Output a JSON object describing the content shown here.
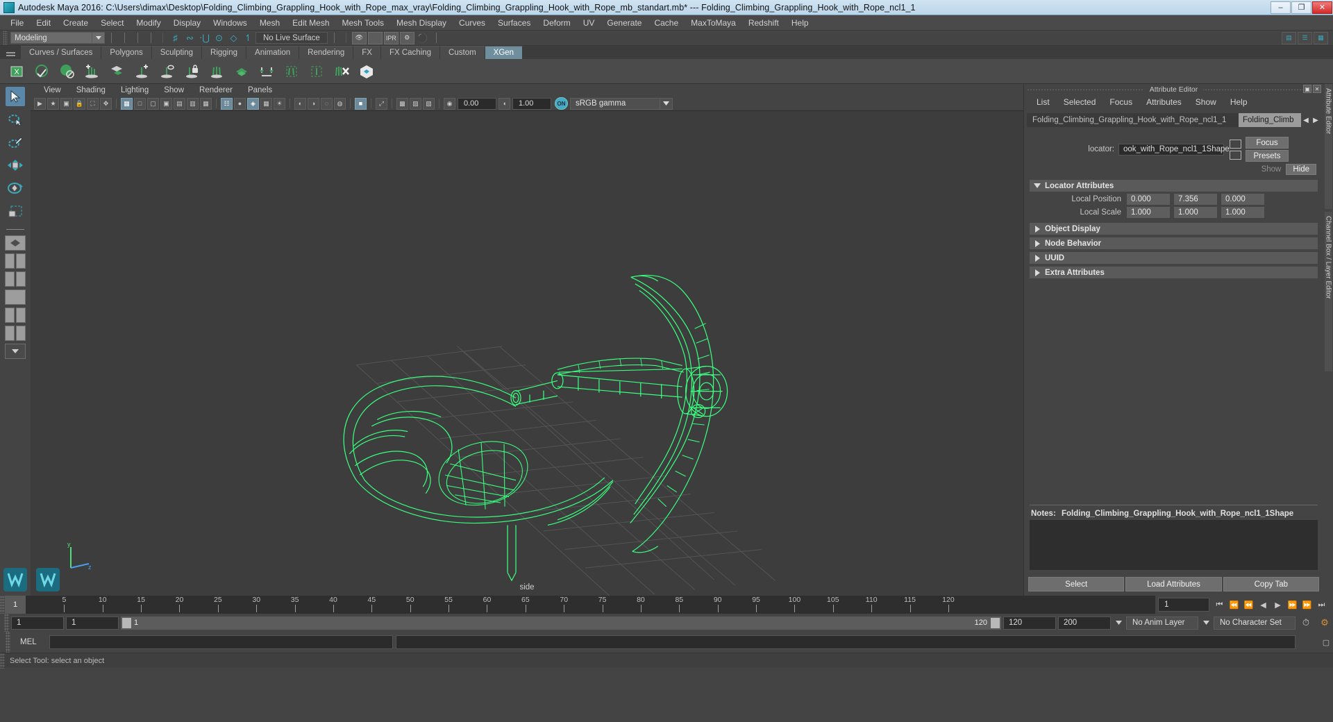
{
  "titlebar": {
    "app_title": "Autodesk Maya 2016: C:\\Users\\dimax\\Desktop\\Folding_Climbing_Grappling_Hook_with_Rope_max_vray\\Folding_Climbing_Grappling_Hook_with_Rope_mb_standart.mb*  ---  Folding_Climbing_Grappling_Hook_with_Rope_ncl1_1",
    "minimize": "–",
    "maximize": "❐",
    "close": "✕"
  },
  "menubar": {
    "items": [
      "File",
      "Edit",
      "Create",
      "Select",
      "Modify",
      "Display",
      "Windows",
      "Mesh",
      "Edit Mesh",
      "Mesh Tools",
      "Mesh Display",
      "Curves",
      "Surfaces",
      "Deform",
      "UV",
      "Generate",
      "Cache",
      "MaxToMaya",
      "Redshift",
      "Help"
    ]
  },
  "statusline": {
    "menuset": "Modeling",
    "live_surface": "No Live Surface",
    "snap_icons": [
      "snap-grid-icon",
      "snap-curve-icon",
      "snap-point-icon",
      "snap-projected-center-icon",
      "snap-view-plane-icon",
      "make-live-icon"
    ],
    "render_icons": [
      "render-current-frame-icon",
      "ipr-render-icon",
      "render-settings-icon",
      "hypershade-icon"
    ],
    "right_icons": [
      "show-hide-ui-icon",
      "channel-box-toggle-icon",
      "attribute-editor-toggle-icon"
    ]
  },
  "shelf": {
    "tabs": [
      "Curves / Surfaces",
      "Polygons",
      "Sculpting",
      "Rigging",
      "Animation",
      "Rendering",
      "FX",
      "FX Caching",
      "Custom",
      "XGen"
    ],
    "active_tab": "XGen",
    "icons": [
      "xgen-editor-icon",
      "xgen-sphere-icon",
      "xgen-ball-icon",
      "xgen-add-icon",
      "xgen-import-icon",
      "xgen-add-guide-icon",
      "xgen-preview-icon",
      "xgen-lock-icon",
      "xgen-groom-icon",
      "xgen-patch-icon",
      "xgen-convert-icon",
      "xgen-select-region-icon",
      "xgen-box-icon",
      "xgen-delete-icon",
      "maya-node-icon"
    ]
  },
  "toolbox": {
    "tools": [
      "select-tool",
      "lasso-select-tool",
      "paint-select-tool",
      "move-tool",
      "rotate-tool",
      "scale-tool"
    ],
    "selected": "select-tool",
    "layouts": [
      "single-perspective-layout",
      "four-view-layout",
      "outliner-persp-layout",
      "persp-graph-layout",
      "hypershade-persp-layout",
      "persp-outliner-graph-layout",
      "more-layouts"
    ]
  },
  "viewport": {
    "menus": [
      "View",
      "Shading",
      "Lighting",
      "Show",
      "Renderer",
      "Panels"
    ],
    "exposure_value": "0.00",
    "gamma_value": "1.00",
    "color_management": "sRGB gamma",
    "toggle_label": "ON",
    "camera_label": "side",
    "axis_labels": {
      "y": "y",
      "z": "z"
    },
    "toolbar_icons": [
      "select-camera-icon",
      "bookmark-icon",
      "camera-attributes-icon",
      "image-plane-icon",
      "two-d-pan-zoom-icon",
      "grid-icon",
      "film-gate-icon",
      "resolution-gate-icon",
      "gate-mask-icon",
      "field-chart-icon",
      "safe-action-icon",
      "safe-title-icon",
      "xray-icon",
      "xray-joints-icon",
      "wireframe-icon",
      "smooth-shade-icon",
      "flat-shade-icon",
      "shaded-wireframe-icon",
      "textured-icon",
      "lighting-icon",
      "shadows-icon",
      "screen-space-ao-icon",
      "motion-blur-icon",
      "multisample-icon",
      "depth-peeling-icon",
      "isolate-select-icon",
      "grid-toggle-icon",
      "film-origin-icon",
      "exposure-icon",
      "gamma-icon",
      "color-management-icon"
    ]
  },
  "attribute_editor": {
    "panel_title": "Attribute Editor",
    "menus": [
      "List",
      "Selected",
      "Focus",
      "Attributes",
      "Show",
      "Help"
    ],
    "tab_primary": "Folding_Climbing_Grappling_Hook_with_Rope_ncl1_1",
    "tab_secondary": "Folding_Climb",
    "node_type_label": "locator:",
    "node_name": "ook_with_Rope_ncl1_1Shape",
    "buttons": {
      "focus": "Focus",
      "presets": "Presets",
      "show": "Show",
      "hide": "Hide"
    },
    "sections": [
      {
        "name": "Locator Attributes",
        "expanded": true
      },
      {
        "name": "Object Display",
        "expanded": false
      },
      {
        "name": "Node Behavior",
        "expanded": false
      },
      {
        "name": "UUID",
        "expanded": false
      },
      {
        "name": "Extra Attributes",
        "expanded": false
      }
    ],
    "locator_attributes": [
      {
        "label": "Local Position",
        "values": [
          "0.000",
          "7.356",
          "0.000"
        ]
      },
      {
        "label": "Local Scale",
        "values": [
          "1.000",
          "1.000",
          "1.000"
        ]
      }
    ],
    "notes_label": "Notes:",
    "notes_value": "Folding_Climbing_Grappling_Hook_with_Rope_ncl1_1Shape",
    "notes_text": "",
    "bottom_buttons": [
      "Select",
      "Load Attributes",
      "Copy Tab"
    ],
    "side_tabs": [
      "Attribute Editor",
      "Channel Box / Layer Editor"
    ]
  },
  "timeline": {
    "current_frame_marker": "1",
    "tick_labels": [
      "5",
      "10",
      "15",
      "20",
      "25",
      "30",
      "35",
      "40",
      "45",
      "50",
      "55",
      "60",
      "65",
      "70",
      "75",
      "80",
      "85",
      "90",
      "95",
      "100",
      "105",
      "110",
      "115",
      "120"
    ],
    "current_frame_field": "1",
    "transport_icons": [
      "go-to-start-icon",
      "step-back-key-icon",
      "step-back-frame-icon",
      "play-backwards-icon",
      "play-forwards-icon",
      "step-forward-frame-icon",
      "step-forward-key-icon",
      "go-to-end-icon"
    ]
  },
  "range": {
    "anim_start": "1",
    "range_start": "1",
    "slider_left_value": "1",
    "slider_right_value": "120",
    "range_end": "120",
    "anim_end": "200",
    "anim_layer": "No Anim Layer",
    "character_set": "No Character Set",
    "right_icons": [
      "auto-key-icon",
      "animation-preferences-icon"
    ]
  },
  "command_line": {
    "language_label": "MEL",
    "input_value": "",
    "output_value": "",
    "script-editor-icon": "script-editor-icon"
  },
  "status_bar": {
    "message": "Select Tool: select an object"
  },
  "colors": {
    "wireframe_green": "#3aff7f",
    "accent_teal": "#3ba8bd",
    "tab_active": "#6f8f9e",
    "panel_bg": "#444444",
    "viewport_bg": "#3d3d3d"
  }
}
